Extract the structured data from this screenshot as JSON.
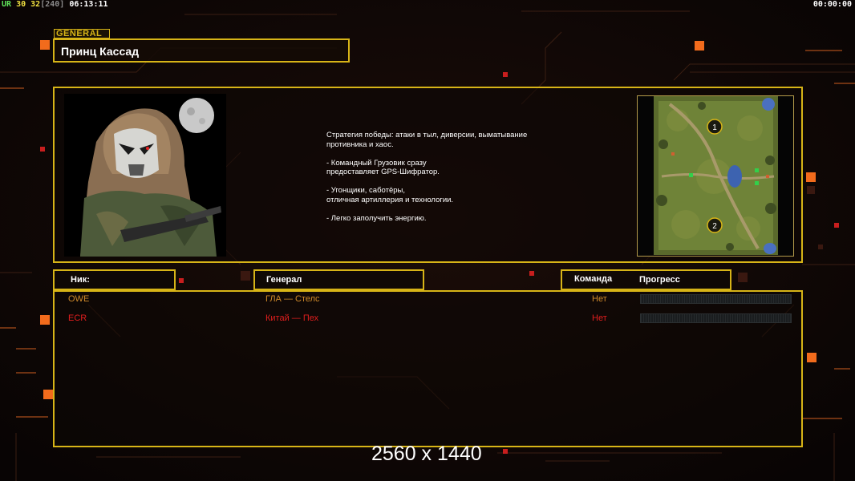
{
  "hud": {
    "left": [
      {
        "text": "UR",
        "color": "green"
      },
      {
        "text": "30",
        "color": "yellow"
      },
      {
        "text": "32",
        "color": "yellow"
      },
      {
        "text": "[240]",
        "color": "grey"
      },
      {
        "text": "06:13:11",
        "color": "white"
      }
    ],
    "right_timer": "00:00:00"
  },
  "general": {
    "tag": "GENERAL",
    "name": "Принц Кассад",
    "description": "Стратегия победы: атаки в тыл, диверсии, выматывание\n противника и хаос.\n\n- Командный Грузовик сразу\nпредоставляет GPS-Шифратор.\n\n- Угонщики, саботёры,\nотличная артиллерия и технологии.\n\n- Легко заполучить энергию.",
    "portrait_icon": "general-portrait-hooded-mask"
  },
  "minimap": {
    "markers": [
      "1",
      "2"
    ]
  },
  "table": {
    "headers": {
      "nick": "Ник:",
      "general": "Генерал",
      "team": "Команда",
      "progress": "Прогресс"
    },
    "rows": [
      {
        "nick": "OWE",
        "general": "ГЛА — Стелс",
        "team": "Нет",
        "color": "#d08a2a",
        "progress": 0
      },
      {
        "nick": "ECR",
        "general": "Китай — Пех",
        "team": "Нет",
        "color": "#e01e1e",
        "progress": 0
      }
    ]
  },
  "resolution_label": "2560 x 1440",
  "colors": {
    "frame": "#d7b417",
    "accent": "#f26b1c",
    "background": "#0c0707"
  }
}
